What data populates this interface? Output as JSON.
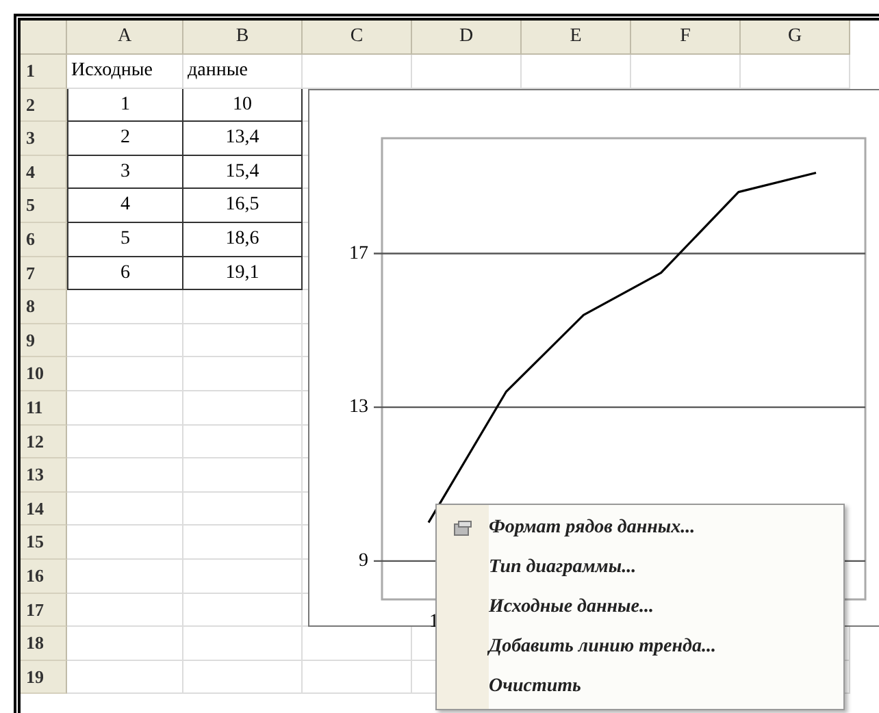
{
  "sheet": {
    "columns": [
      "A",
      "B",
      "C",
      "D",
      "E",
      "F",
      "G"
    ],
    "rows": [
      {
        "label": "1",
        "bordered": false,
        "cells": [
          "Исходные",
          "данные"
        ]
      },
      {
        "label": "2",
        "bordered": true,
        "cells": [
          "1",
          "10"
        ]
      },
      {
        "label": "3",
        "bordered": true,
        "cells": [
          "2",
          "13,4"
        ]
      },
      {
        "label": "4",
        "bordered": true,
        "cells": [
          "3",
          "15,4"
        ]
      },
      {
        "label": "5",
        "bordered": true,
        "cells": [
          "4",
          "16,5"
        ]
      },
      {
        "label": "6",
        "bordered": true,
        "cells": [
          "5",
          "18,6"
        ]
      },
      {
        "label": "7",
        "bordered": true,
        "cells": [
          "6",
          "19,1"
        ]
      },
      {
        "label": "8"
      },
      {
        "label": "9"
      },
      {
        "label": "10"
      },
      {
        "label": "11"
      },
      {
        "label": "12"
      },
      {
        "label": "13"
      },
      {
        "label": "14"
      },
      {
        "label": "15"
      },
      {
        "label": "16"
      },
      {
        "label": "17"
      },
      {
        "label": "18"
      },
      {
        "label": "19"
      }
    ]
  },
  "chart": {
    "category_labels": [
      "1"
    ],
    "chart_data": {
      "type": "line",
      "grid": true,
      "series": [
        {
          "color": "#000000",
          "values": [
            10,
            13.4,
            15.4,
            16.5,
            18.6,
            19.1
          ]
        }
      ],
      "ylim": [
        8,
        20
      ],
      "yticks": [
        9,
        13,
        17
      ]
    }
  },
  "context_menu": {
    "items": [
      {
        "label": "Формат рядов данных...",
        "kind": "icon"
      },
      {
        "label": "Тип диаграммы...",
        "kind": "plain"
      },
      {
        "label": "Исходные данные...",
        "kind": "plain"
      },
      {
        "label": "Добавить линию тренда...",
        "kind": "plain"
      },
      {
        "label": "Очистить",
        "kind": "plain"
      }
    ]
  }
}
